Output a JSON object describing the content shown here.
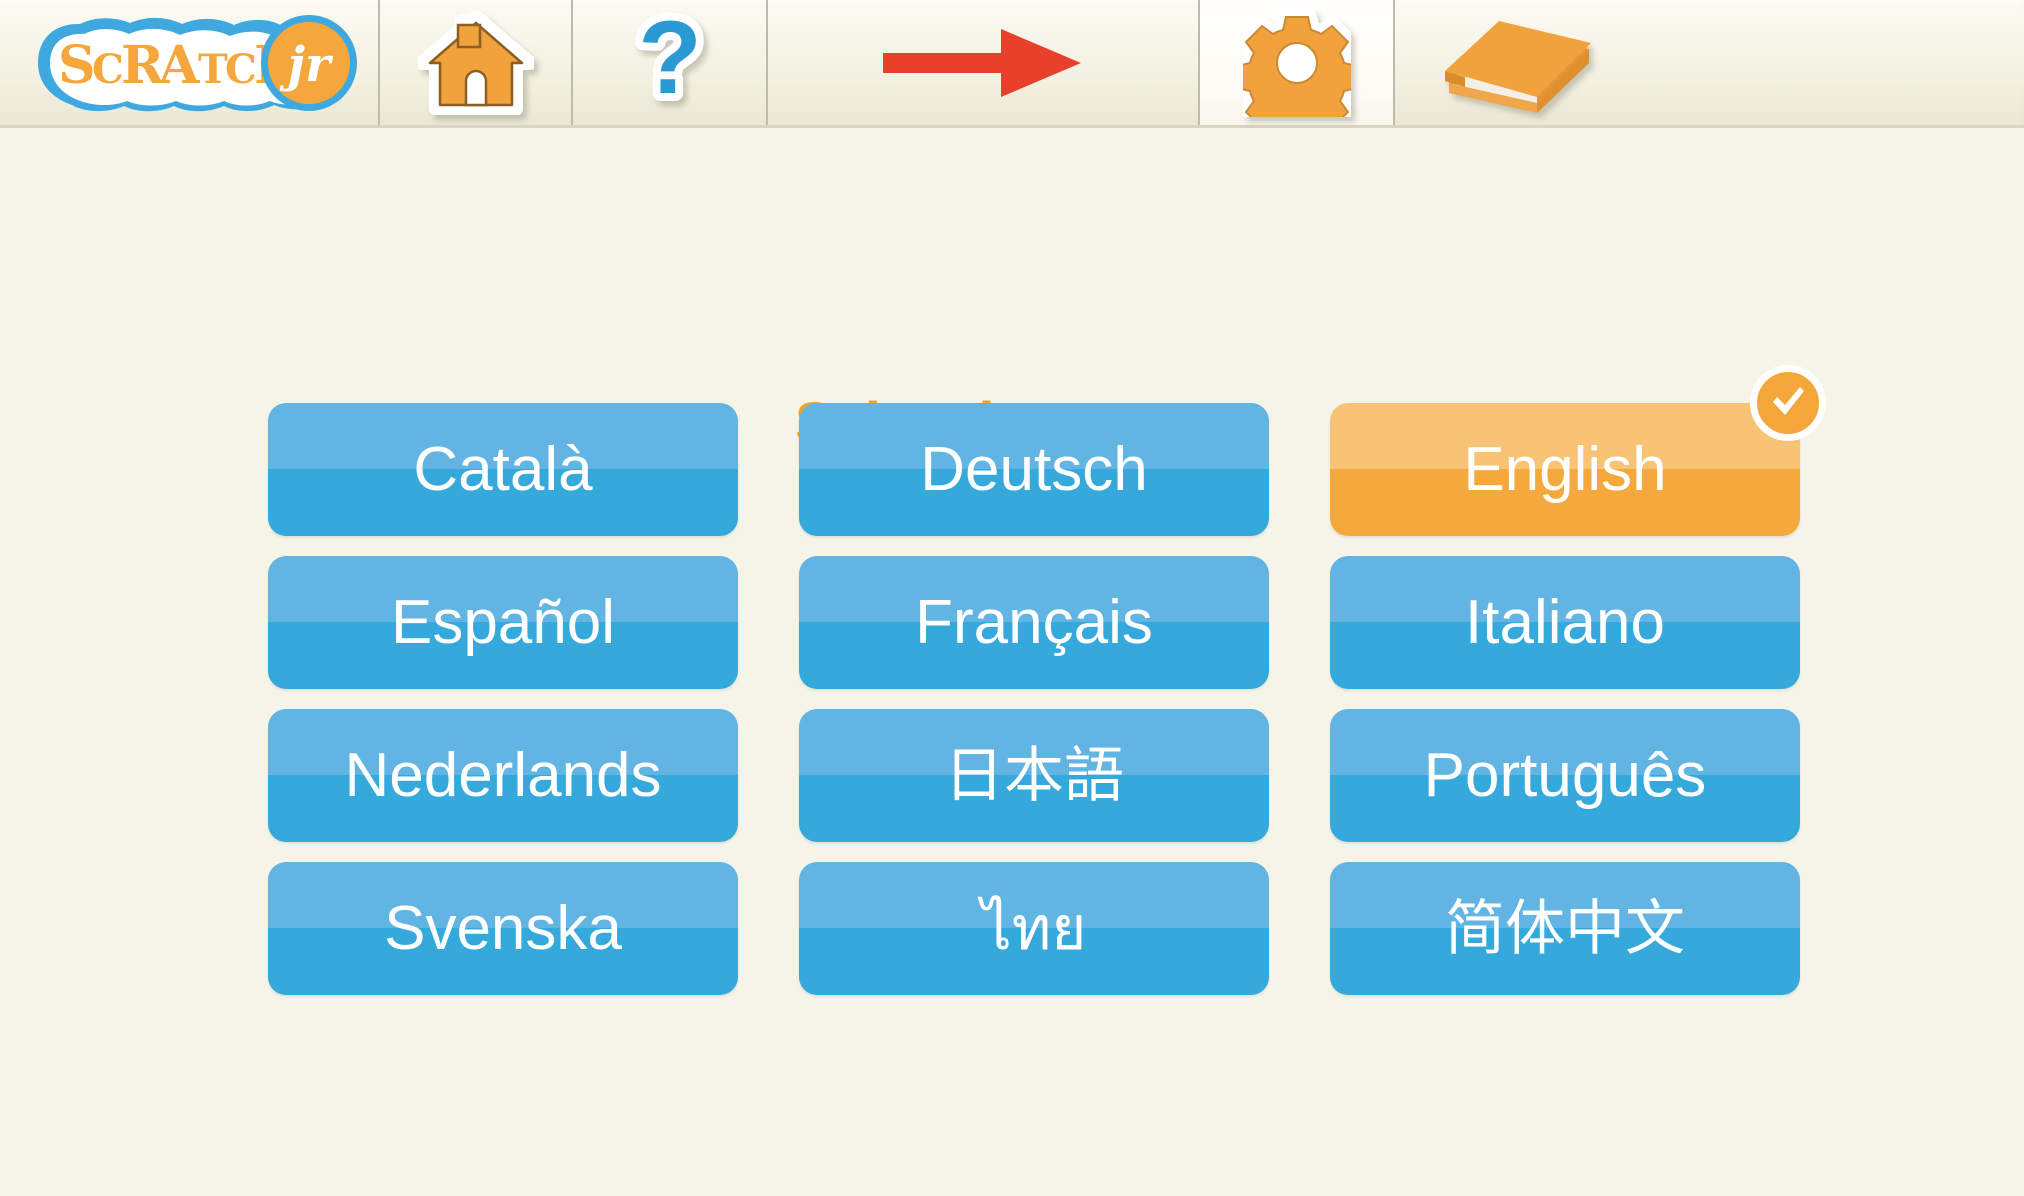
{
  "app": {
    "name": "ScratchJr",
    "logo_text": "SCRATCH",
    "logo_badge_text": "jr",
    "background_color": "#f5f4e9"
  },
  "toolbar": {
    "items": [
      {
        "id": "logo",
        "name": "scratchjr-logo",
        "label": "ScratchJr",
        "icon": "scratchjr-logo",
        "active": false
      },
      {
        "id": "home",
        "name": "home-button",
        "label": "Home",
        "icon": "home-icon",
        "active": false
      },
      {
        "id": "help",
        "name": "help-button",
        "label": "Help",
        "icon": "question-mark-icon",
        "active": false
      },
      {
        "id": "next",
        "name": "forward-arrow",
        "label": "Forward",
        "icon": "right-arrow-icon",
        "active": false
      },
      {
        "id": "settings",
        "name": "settings-button",
        "label": "Settings",
        "icon": "gear-icon",
        "active": true
      },
      {
        "id": "book",
        "name": "book-button",
        "label": "Book",
        "icon": "book-icon",
        "active": false
      }
    ],
    "colors": {
      "orange": "#f2a23c",
      "orange_stroke": "#8a5f24",
      "blue": "#2b9ad4",
      "red_arrow": "#e8412b",
      "active_tab_bg": "#fdfcf6",
      "inactive_tab_bg": "#f3f1e1",
      "divider": "#bdbbae"
    }
  },
  "main": {
    "title": "Select language",
    "title_color": "#f2a22b",
    "selected_language": "English",
    "check_badge_icon": "check-icon",
    "button_colors": {
      "blue_top": "#62b5e2",
      "blue_bottom": "#35a8dc",
      "orange_top": "#f9c376",
      "orange_bottom": "#f5a93d",
      "text": "#ffffff"
    },
    "languages": [
      {
        "code": "ca",
        "label": "Català",
        "selected": false,
        "script": "latin"
      },
      {
        "code": "de",
        "label": "Deutsch",
        "selected": false,
        "script": "latin"
      },
      {
        "code": "en",
        "label": "English",
        "selected": true,
        "script": "latin"
      },
      {
        "code": "es",
        "label": "Español",
        "selected": false,
        "script": "latin"
      },
      {
        "code": "fr",
        "label": "Français",
        "selected": false,
        "script": "latin"
      },
      {
        "code": "it",
        "label": "Italiano",
        "selected": false,
        "script": "latin"
      },
      {
        "code": "nl",
        "label": "Nederlands",
        "selected": false,
        "script": "latin"
      },
      {
        "code": "ja",
        "label": "日本語",
        "selected": false,
        "script": "cjk"
      },
      {
        "code": "pt",
        "label": "Português",
        "selected": false,
        "script": "latin"
      },
      {
        "code": "sv",
        "label": "Svenska",
        "selected": false,
        "script": "latin"
      },
      {
        "code": "th",
        "label": "ไทย",
        "selected": false,
        "script": "thai"
      },
      {
        "code": "zh-CN",
        "label": "简体中文",
        "selected": false,
        "script": "cjk"
      }
    ]
  }
}
